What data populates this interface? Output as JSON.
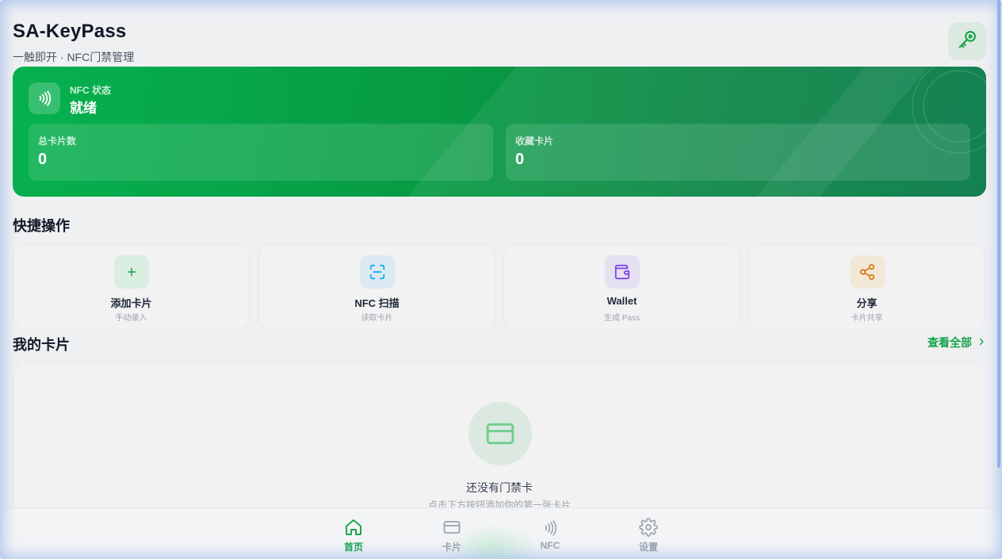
{
  "header": {
    "title": "SA-KeyPass",
    "subtitle": "一触即开 · NFC门禁管理",
    "key_icon": "key-icon"
  },
  "hero": {
    "nfc_status_label": "NFC 状态",
    "nfc_status_value": "就绪",
    "stats": [
      {
        "label": "总卡片数",
        "value": "0"
      },
      {
        "label": "收藏卡片",
        "value": "0"
      }
    ]
  },
  "quick_actions": {
    "title": "快捷操作",
    "items": [
      {
        "label": "添加卡片",
        "sub": "手动录入",
        "icon": "plus-icon",
        "color": "#16a34a"
      },
      {
        "label": "NFC 扫描",
        "sub": "读取卡片",
        "icon": "scan-icon",
        "color": "#0ea5e9"
      },
      {
        "label": "Wallet",
        "sub": "生成 Pass",
        "icon": "wallet-icon",
        "color": "#7c3aed"
      },
      {
        "label": "分享",
        "sub": "卡片共享",
        "icon": "share-icon",
        "color": "#d97706"
      }
    ]
  },
  "my_cards": {
    "title": "我的卡片",
    "view_all": "查看全部",
    "empty_title": "还没有门禁卡",
    "empty_sub": "点击下方按钮添加你的第一张卡片"
  },
  "bottom_nav": {
    "items": [
      {
        "label": "首页",
        "icon": "home-icon",
        "active": true
      },
      {
        "label": "卡片",
        "icon": "card-icon",
        "active": false
      },
      {
        "label": "NFC",
        "icon": "nfc-icon",
        "active": false
      },
      {
        "label": "设置",
        "icon": "gear-icon",
        "active": false
      }
    ]
  },
  "colors": {
    "accent": "#16a34a",
    "hero_start": "#07b14f",
    "hero_end": "#067a48"
  }
}
